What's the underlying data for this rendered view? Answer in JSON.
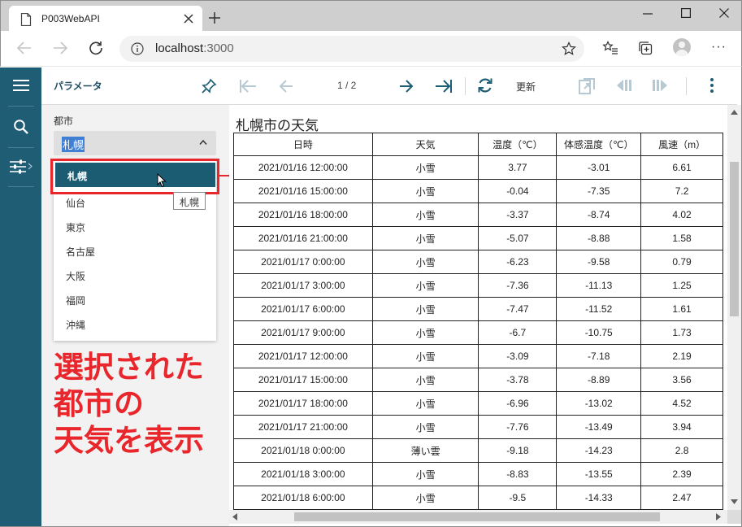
{
  "browser": {
    "tab_title": "P003WebAPI",
    "url_host": "localhost",
    "url_port": ":3000"
  },
  "toolbar": {
    "panel_title": "パラメータ",
    "page_indicator": "1 / 2",
    "refresh_label": "更新"
  },
  "parameter": {
    "label": "都市",
    "selected": "札幌",
    "options": [
      "札幌",
      "仙台",
      "東京",
      "名古屋",
      "大阪",
      "福岡",
      "沖縄"
    ],
    "tooltip": "札幌"
  },
  "annotation": {
    "line1": "選択された",
    "line2": "都市の",
    "line3": "天気を表示"
  },
  "report": {
    "title": "札幌市の天気",
    "columns": [
      "日時",
      "天気",
      "温度（℃）",
      "体感温度（℃）",
      "風速（m）"
    ],
    "rows": [
      [
        "2021/01/16 12:00:00",
        "小雪",
        "3.77",
        "-3.01",
        "6.61"
      ],
      [
        "2021/01/16 15:00:00",
        "小雪",
        "-0.04",
        "-7.35",
        "7.2"
      ],
      [
        "2021/01/16 18:00:00",
        "小雪",
        "-3.37",
        "-8.74",
        "4.02"
      ],
      [
        "2021/01/16 21:00:00",
        "小雪",
        "-5.07",
        "-8.88",
        "1.58"
      ],
      [
        "2021/01/17 0:00:00",
        "小雪",
        "-6.23",
        "-9.58",
        "0.79"
      ],
      [
        "2021/01/17 3:00:00",
        "小雪",
        "-7.36",
        "-11.13",
        "1.25"
      ],
      [
        "2021/01/17 6:00:00",
        "小雪",
        "-7.47",
        "-11.52",
        "1.61"
      ],
      [
        "2021/01/17 9:00:00",
        "小雪",
        "-6.7",
        "-10.75",
        "1.73"
      ],
      [
        "2021/01/17 12:00:00",
        "小雪",
        "-3.09",
        "-7.18",
        "2.19"
      ],
      [
        "2021/01/17 15:00:00",
        "小雪",
        "-3.78",
        "-8.89",
        "3.56"
      ],
      [
        "2021/01/17 18:00:00",
        "小雪",
        "-6.96",
        "-13.02",
        "4.52"
      ],
      [
        "2021/01/17 21:00:00",
        "小雪",
        "-7.76",
        "-13.49",
        "3.94"
      ],
      [
        "2021/01/18 0:00:00",
        "薄い雲",
        "-9.18",
        "-14.23",
        "2.8"
      ],
      [
        "2021/01/18 3:00:00",
        "小雪",
        "-8.83",
        "-13.55",
        "2.39"
      ],
      [
        "2021/01/18 6:00:00",
        "小雪",
        "-9.5",
        "-14.33",
        "2.47"
      ]
    ]
  },
  "colors": {
    "accent": "#1f5d75",
    "annotation_red": "#e8262b",
    "selected_item": "#1c5c73"
  }
}
